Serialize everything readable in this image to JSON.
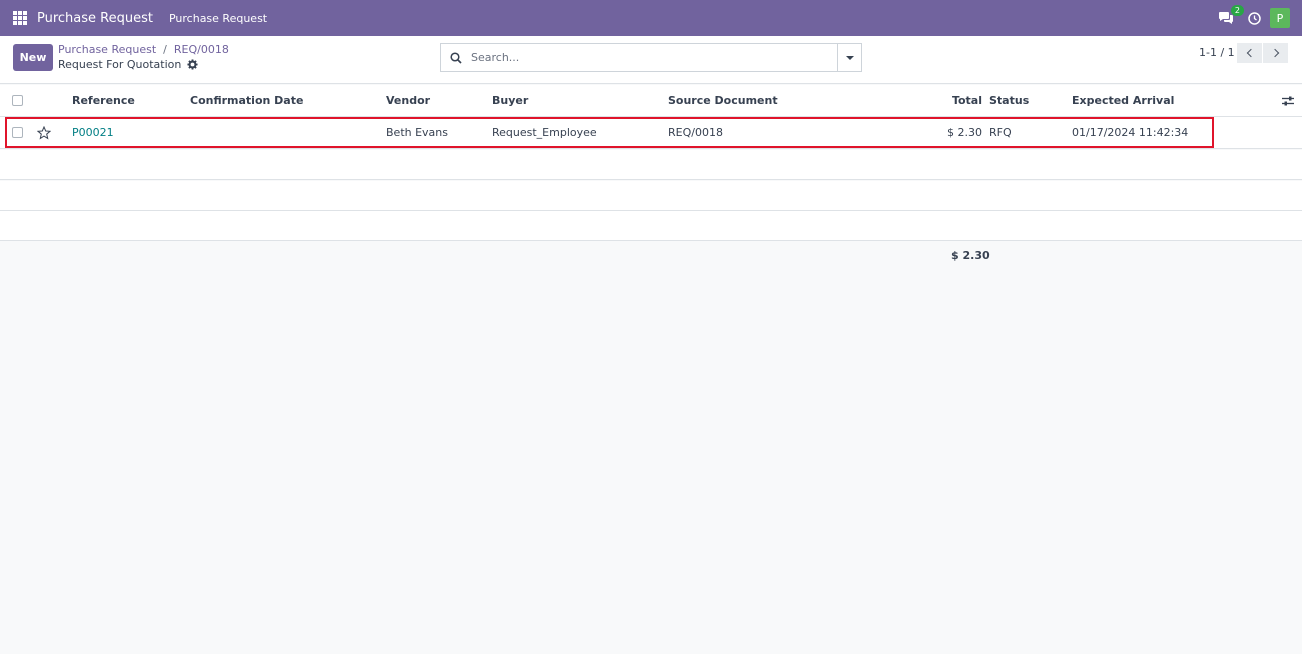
{
  "navbar": {
    "app_name": "Purchase Request",
    "menu_item": "Purchase Request",
    "chat_badge": "2",
    "avatar_letter": "P",
    "colors": {
      "brand": "#71639e",
      "badge": "#28a745",
      "avatar": "#5cb85c"
    }
  },
  "control": {
    "new_label": "New",
    "breadcrumb": [
      "Purchase Request",
      "REQ/0018"
    ],
    "breadcrumb_sep": "/",
    "view_title": "Request For Quotation",
    "search_placeholder": "Search...",
    "pager": "1-1 / 1"
  },
  "table": {
    "columns": [
      "Reference",
      "Confirmation Date",
      "Vendor",
      "Buyer",
      "Source Document",
      "Total",
      "Status",
      "Expected Arrival"
    ],
    "rows": [
      {
        "reference": "P00021",
        "confirmation_date": "",
        "vendor": "Beth Evans",
        "buyer": "Request_Employee",
        "source_document": "REQ/0018",
        "total": "$ 2.30",
        "status": "RFQ",
        "expected_arrival": "01/17/2024 11:42:34"
      }
    ],
    "sum_total": "$ 2.30"
  },
  "icons": [
    "apps-grid-icon",
    "chat-icon",
    "clock-icon",
    "gear-icon",
    "search-icon",
    "chevron-down-icon",
    "chevron-left-icon",
    "chevron-right-icon",
    "star-icon",
    "column-settings-icon"
  ]
}
